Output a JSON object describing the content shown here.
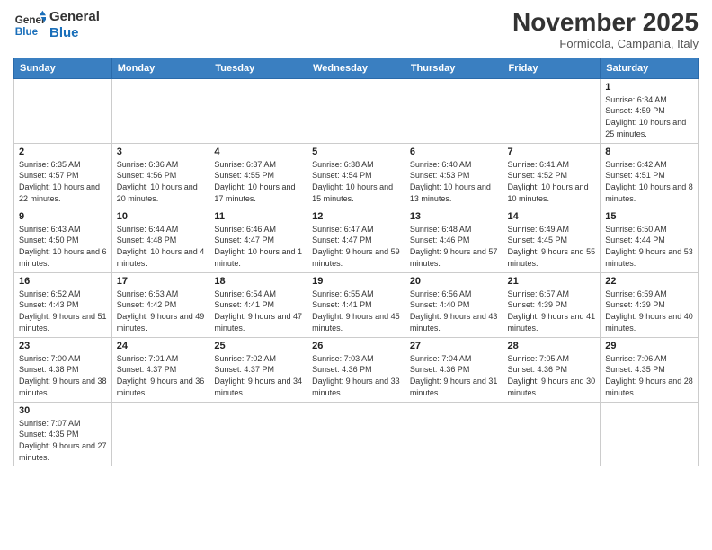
{
  "header": {
    "logo_general": "General",
    "logo_blue": "Blue",
    "title": "November 2025",
    "location": "Formicola, Campania, Italy"
  },
  "weekdays": [
    "Sunday",
    "Monday",
    "Tuesday",
    "Wednesday",
    "Thursday",
    "Friday",
    "Saturday"
  ],
  "weeks": [
    [
      {
        "day": "",
        "info": ""
      },
      {
        "day": "",
        "info": ""
      },
      {
        "day": "",
        "info": ""
      },
      {
        "day": "",
        "info": ""
      },
      {
        "day": "",
        "info": ""
      },
      {
        "day": "",
        "info": ""
      },
      {
        "day": "1",
        "info": "Sunrise: 6:34 AM\nSunset: 4:59 PM\nDaylight: 10 hours and 25 minutes."
      }
    ],
    [
      {
        "day": "2",
        "info": "Sunrise: 6:35 AM\nSunset: 4:57 PM\nDaylight: 10 hours and 22 minutes."
      },
      {
        "day": "3",
        "info": "Sunrise: 6:36 AM\nSunset: 4:56 PM\nDaylight: 10 hours and 20 minutes."
      },
      {
        "day": "4",
        "info": "Sunrise: 6:37 AM\nSunset: 4:55 PM\nDaylight: 10 hours and 17 minutes."
      },
      {
        "day": "5",
        "info": "Sunrise: 6:38 AM\nSunset: 4:54 PM\nDaylight: 10 hours and 15 minutes."
      },
      {
        "day": "6",
        "info": "Sunrise: 6:40 AM\nSunset: 4:53 PM\nDaylight: 10 hours and 13 minutes."
      },
      {
        "day": "7",
        "info": "Sunrise: 6:41 AM\nSunset: 4:52 PM\nDaylight: 10 hours and 10 minutes."
      },
      {
        "day": "8",
        "info": "Sunrise: 6:42 AM\nSunset: 4:51 PM\nDaylight: 10 hours and 8 minutes."
      }
    ],
    [
      {
        "day": "9",
        "info": "Sunrise: 6:43 AM\nSunset: 4:50 PM\nDaylight: 10 hours and 6 minutes."
      },
      {
        "day": "10",
        "info": "Sunrise: 6:44 AM\nSunset: 4:48 PM\nDaylight: 10 hours and 4 minutes."
      },
      {
        "day": "11",
        "info": "Sunrise: 6:46 AM\nSunset: 4:47 PM\nDaylight: 10 hours and 1 minute."
      },
      {
        "day": "12",
        "info": "Sunrise: 6:47 AM\nSunset: 4:47 PM\nDaylight: 9 hours and 59 minutes."
      },
      {
        "day": "13",
        "info": "Sunrise: 6:48 AM\nSunset: 4:46 PM\nDaylight: 9 hours and 57 minutes."
      },
      {
        "day": "14",
        "info": "Sunrise: 6:49 AM\nSunset: 4:45 PM\nDaylight: 9 hours and 55 minutes."
      },
      {
        "day": "15",
        "info": "Sunrise: 6:50 AM\nSunset: 4:44 PM\nDaylight: 9 hours and 53 minutes."
      }
    ],
    [
      {
        "day": "16",
        "info": "Sunrise: 6:52 AM\nSunset: 4:43 PM\nDaylight: 9 hours and 51 minutes."
      },
      {
        "day": "17",
        "info": "Sunrise: 6:53 AM\nSunset: 4:42 PM\nDaylight: 9 hours and 49 minutes."
      },
      {
        "day": "18",
        "info": "Sunrise: 6:54 AM\nSunset: 4:41 PM\nDaylight: 9 hours and 47 minutes."
      },
      {
        "day": "19",
        "info": "Sunrise: 6:55 AM\nSunset: 4:41 PM\nDaylight: 9 hours and 45 minutes."
      },
      {
        "day": "20",
        "info": "Sunrise: 6:56 AM\nSunset: 4:40 PM\nDaylight: 9 hours and 43 minutes."
      },
      {
        "day": "21",
        "info": "Sunrise: 6:57 AM\nSunset: 4:39 PM\nDaylight: 9 hours and 41 minutes."
      },
      {
        "day": "22",
        "info": "Sunrise: 6:59 AM\nSunset: 4:39 PM\nDaylight: 9 hours and 40 minutes."
      }
    ],
    [
      {
        "day": "23",
        "info": "Sunrise: 7:00 AM\nSunset: 4:38 PM\nDaylight: 9 hours and 38 minutes."
      },
      {
        "day": "24",
        "info": "Sunrise: 7:01 AM\nSunset: 4:37 PM\nDaylight: 9 hours and 36 minutes."
      },
      {
        "day": "25",
        "info": "Sunrise: 7:02 AM\nSunset: 4:37 PM\nDaylight: 9 hours and 34 minutes."
      },
      {
        "day": "26",
        "info": "Sunrise: 7:03 AM\nSunset: 4:36 PM\nDaylight: 9 hours and 33 minutes."
      },
      {
        "day": "27",
        "info": "Sunrise: 7:04 AM\nSunset: 4:36 PM\nDaylight: 9 hours and 31 minutes."
      },
      {
        "day": "28",
        "info": "Sunrise: 7:05 AM\nSunset: 4:36 PM\nDaylight: 9 hours and 30 minutes."
      },
      {
        "day": "29",
        "info": "Sunrise: 7:06 AM\nSunset: 4:35 PM\nDaylight: 9 hours and 28 minutes."
      }
    ],
    [
      {
        "day": "30",
        "info": "Sunrise: 7:07 AM\nSunset: 4:35 PM\nDaylight: 9 hours and 27 minutes."
      },
      {
        "day": "",
        "info": ""
      },
      {
        "day": "",
        "info": ""
      },
      {
        "day": "",
        "info": ""
      },
      {
        "day": "",
        "info": ""
      },
      {
        "day": "",
        "info": ""
      },
      {
        "day": "",
        "info": ""
      }
    ]
  ]
}
